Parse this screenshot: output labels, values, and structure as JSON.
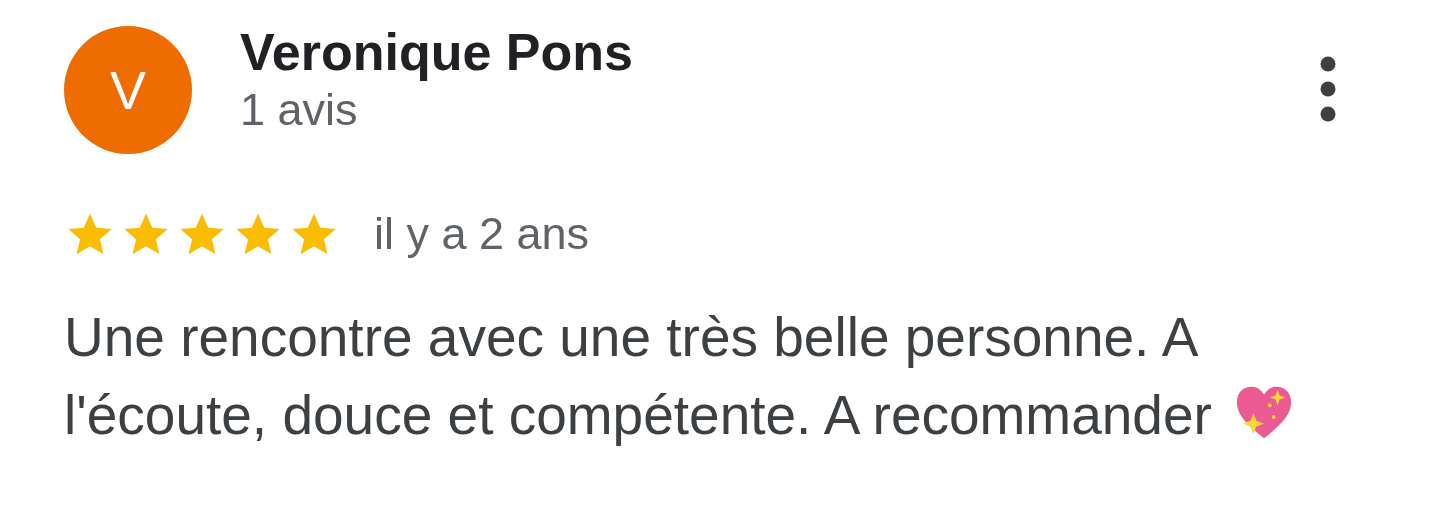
{
  "reviewer": {
    "initial": "V",
    "name": "Veronique Pons",
    "review_count": "1 avis"
  },
  "review": {
    "stars": 5,
    "date": "il y a 2 ans",
    "text": "Une rencontre avec une très belle personne. A l'écoute, douce et compétente. A recommander"
  }
}
